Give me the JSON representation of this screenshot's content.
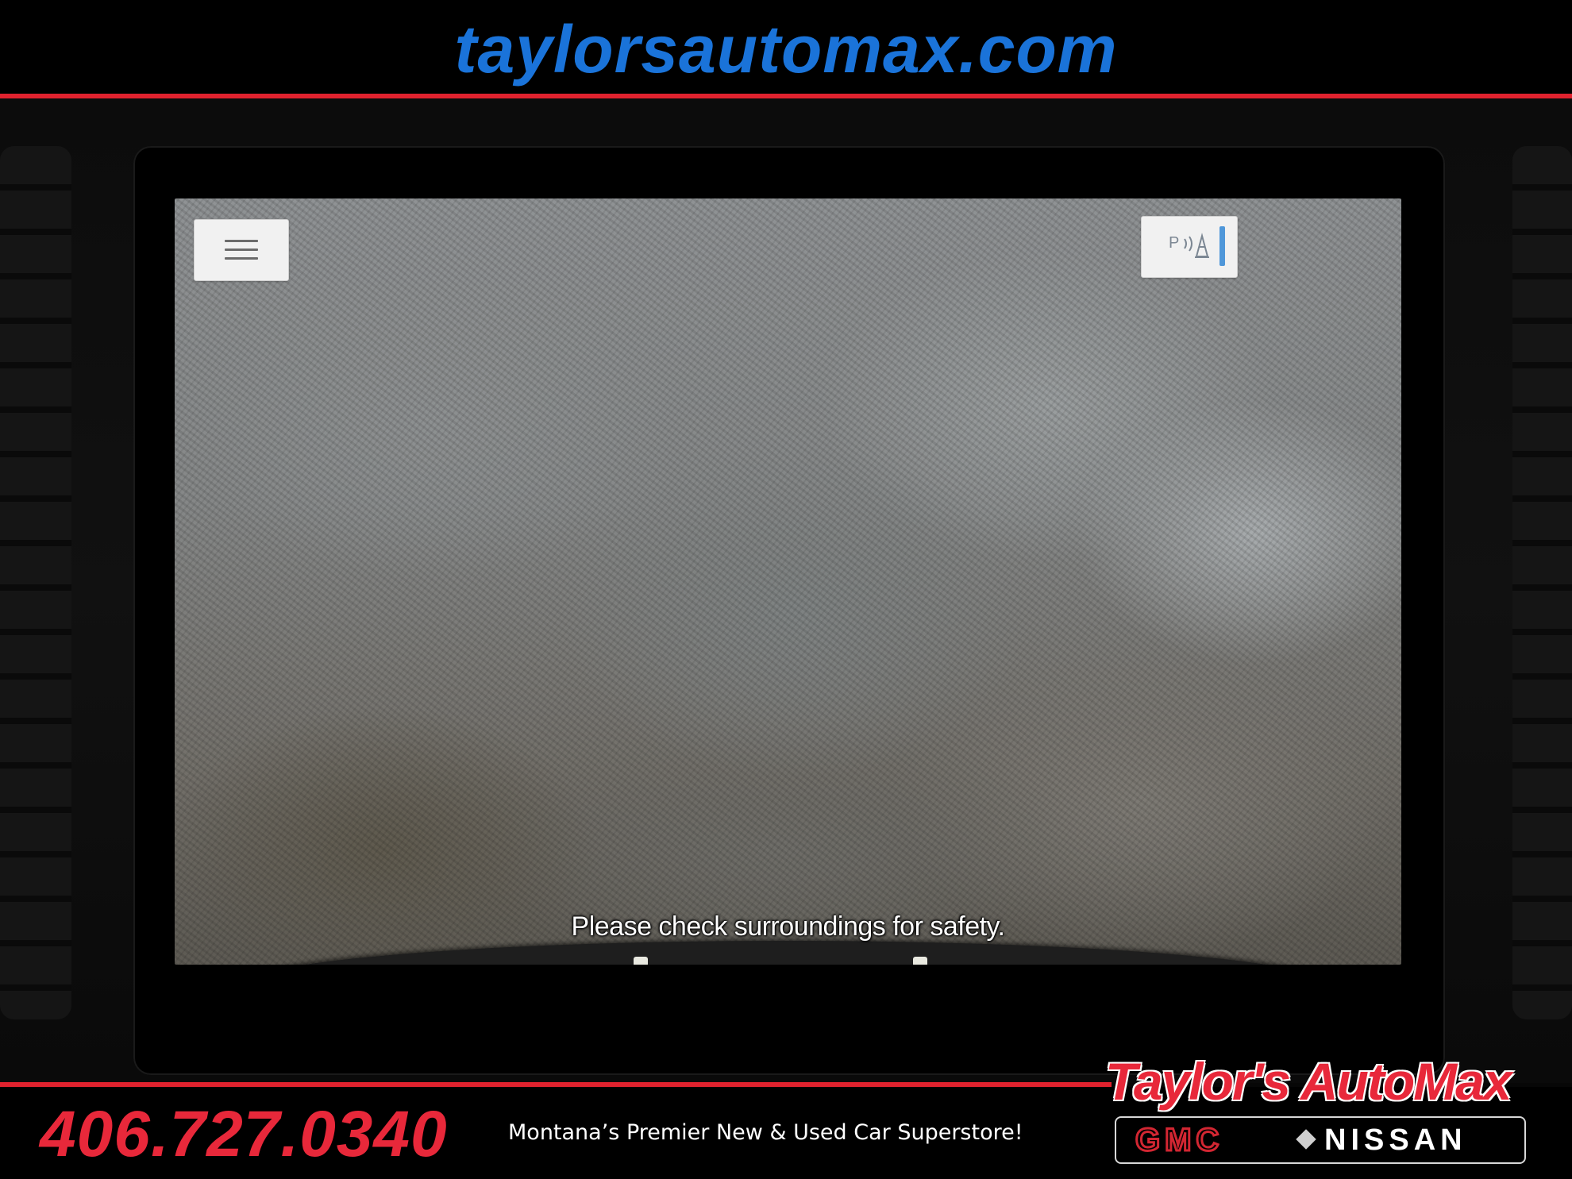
{
  "header": {
    "website": "taylorsautomax.com"
  },
  "camera_screen": {
    "menu_button_icon": "hamburger-menu-icon",
    "parking_button": {
      "label": "P",
      "icon": "parking-sensor-cone-icon"
    },
    "safety_message": "Please check surroundings for safety."
  },
  "footer": {
    "phone": "406.727.0340",
    "tagline": "Montana’s Premier New & Used Car Superstore!",
    "dealer_name": "Taylor's AutoMax",
    "brands": [
      "GMC",
      "NISSAN"
    ]
  },
  "colors": {
    "brand_blue": "#1a73d9",
    "brand_red": "#e8283a",
    "accent_bar_blue": "#4f97d9"
  }
}
